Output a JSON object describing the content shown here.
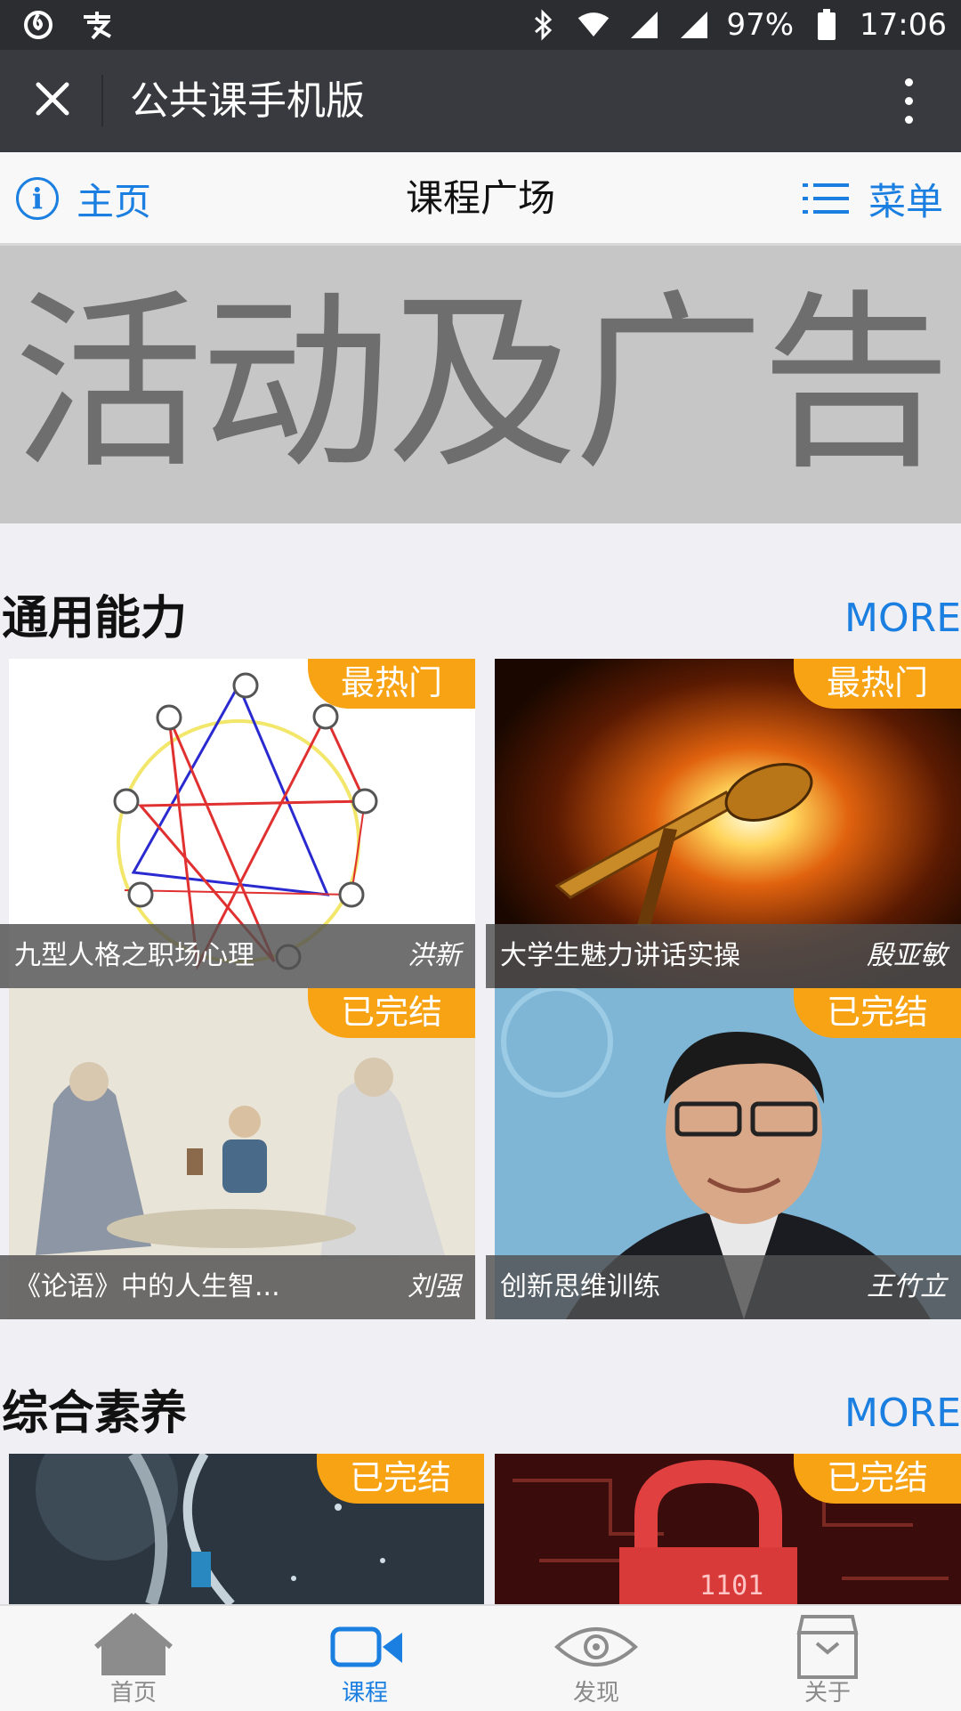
{
  "status_bar": {
    "battery": "97%",
    "time": "17:06",
    "icons": [
      "netease-icon",
      "alipay-icon",
      "bluetooth-icon",
      "wifi-icon",
      "signal-icon",
      "signal-icon",
      "battery-icon"
    ]
  },
  "app_bar": {
    "title": "公共课手机版",
    "icons": [
      "close-icon",
      "more-vert-icon"
    ]
  },
  "sub_header": {
    "home_label": "主页",
    "title": "课程广场",
    "menu_label": "菜单"
  },
  "banner": {
    "text": "活动及广告"
  },
  "sections": [
    {
      "title": "通用能力",
      "more": "MORE",
      "courses": [
        {
          "badge": "最热门",
          "title": "九型人格之职场心理",
          "author": "洪新"
        },
        {
          "badge": "最热门",
          "title": "大学生魅力讲话实操",
          "author": "殷亚敏"
        },
        {
          "badge": "已完结",
          "title": "《论语》中的人生智...",
          "author": "刘强"
        },
        {
          "badge": "已完结",
          "title": "创新思维训练",
          "author": "王竹立"
        }
      ]
    },
    {
      "title": "综合素养",
      "more": "MORE",
      "courses": [
        {
          "badge": "已完结"
        },
        {
          "badge": "已完结"
        }
      ]
    }
  ],
  "bottom_nav": {
    "items": [
      {
        "label": "首页",
        "icon": "home-icon"
      },
      {
        "label": "课程",
        "icon": "video-camera-icon"
      },
      {
        "label": "发现",
        "icon": "eye-icon"
      },
      {
        "label": "关于",
        "icon": "box-icon"
      }
    ],
    "active_index": 1
  },
  "colors": {
    "accent": "#1a7fe0",
    "badge": "#f7a313",
    "status_bar": "#2b2d31",
    "app_bar": "#393a3f"
  }
}
